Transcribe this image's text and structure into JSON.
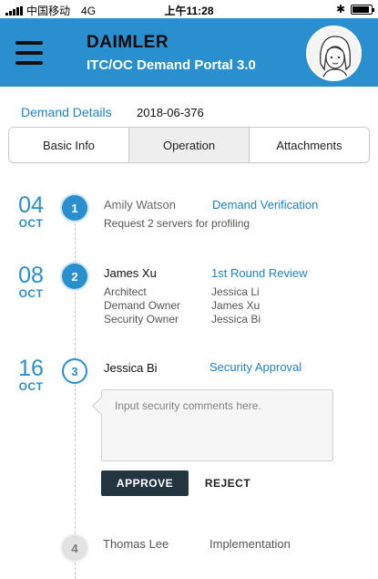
{
  "status_bar": {
    "carrier": "中国移动",
    "network": "4G",
    "time": "上午11:28",
    "battery_level": 0.9
  },
  "header": {
    "brand": "DAIMLER",
    "portal": "ITC/OC Demand Portal 3.0",
    "color": "#2a8fcf"
  },
  "details": {
    "label": "Demand Details",
    "id": "2018-06-376"
  },
  "tabs": [
    {
      "label": "Basic Info",
      "active": false
    },
    {
      "label": "Operation",
      "active": true
    },
    {
      "label": "Attachments",
      "active": false
    }
  ],
  "timeline": [
    {
      "day": "04",
      "month": "OCT",
      "number": "1",
      "person": "Amily Watson",
      "stage": "Demand Verification",
      "description": "Request 2 servers for profiling"
    },
    {
      "day": "08",
      "month": "OCT",
      "number": "2",
      "person": "James Xu",
      "stage": "1st Round Review",
      "roles": [
        {
          "role": "Architect",
          "name": "Jessica Li"
        },
        {
          "role": "Demand Owner",
          "name": "James Xu"
        },
        {
          "role": "Security Owner",
          "name": "Jessica Bi"
        }
      ]
    },
    {
      "day": "16",
      "month": "OCT",
      "number": "3",
      "person": "Jessica Bi",
      "stage": "Security Approval",
      "comment_placeholder": "Input security comments here.",
      "approve_label": "APPROVE",
      "reject_label": "REJECT"
    },
    {
      "number": "4",
      "person": "Thomas Lee",
      "stage": "Implementation"
    }
  ]
}
